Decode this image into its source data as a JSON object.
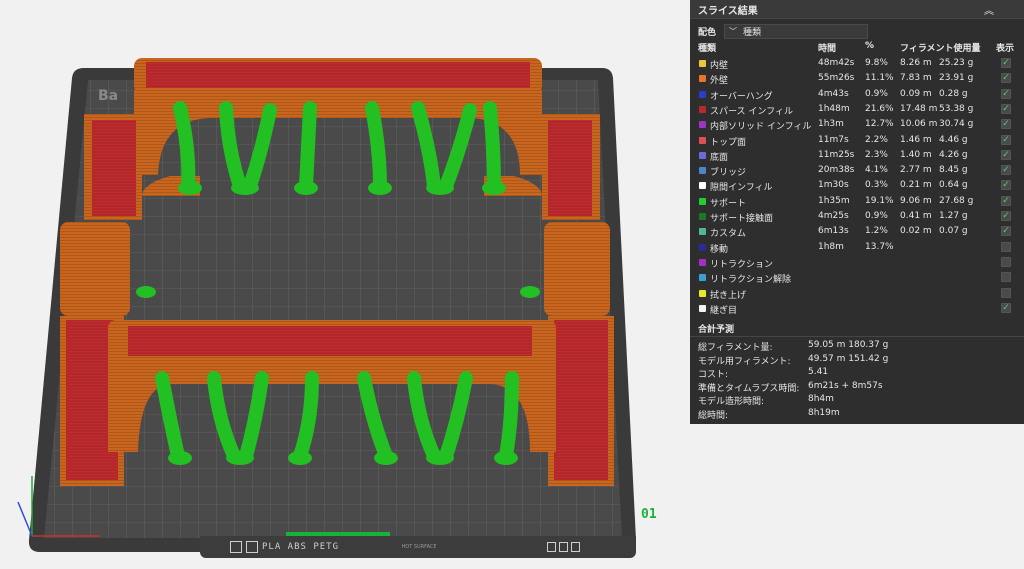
{
  "viewport": {
    "plate_label": "Ba",
    "plate_number": "01",
    "bar_material": "PLA ABS PETG",
    "bar_surface": "HOT SURFACE"
  },
  "panel": {
    "title": "スライス結果",
    "scheme_label": "配色",
    "scheme_value": "種類",
    "headers": {
      "type": "種類",
      "time": "時間",
      "percent": "%",
      "filament": "フィラメント使用量",
      "show": "表示"
    },
    "rows": [
      {
        "name": "内壁",
        "color": "#f0c33c",
        "time": "48m42s",
        "percent": "9.8%",
        "meters": "8.26 m",
        "grams": "25.23 g",
        "checked": true
      },
      {
        "name": "外壁",
        "color": "#e8762a",
        "time": "55m26s",
        "percent": "11.1%",
        "meters": "7.83 m",
        "grams": "23.91 g",
        "checked": true
      },
      {
        "name": "オーバーハング",
        "color": "#2d3bc9",
        "time": "4m43s",
        "percent": "0.9%",
        "meters": "0.09 m",
        "grams": "0.28 g",
        "checked": true
      },
      {
        "name": "スパース インフィル",
        "color": "#b52a2a",
        "time": "1h48m",
        "percent": "21.6%",
        "meters": "17.48 m",
        "grams": "53.38 g",
        "checked": true
      },
      {
        "name": "内部ソリッド インフィル",
        "color": "#9c35c4",
        "time": "1h3m",
        "percent": "12.7%",
        "meters": "10.06 m",
        "grams": "30.74 g",
        "checked": true
      },
      {
        "name": "トップ面",
        "color": "#e05050",
        "time": "11m7s",
        "percent": "2.2%",
        "meters": "1.46 m",
        "grams": "4.46 g",
        "checked": true
      },
      {
        "name": "底面",
        "color": "#6a6ad8",
        "time": "11m25s",
        "percent": "2.3%",
        "meters": "1.40 m",
        "grams": "4.26 g",
        "checked": true
      },
      {
        "name": "ブリッジ",
        "color": "#4a86c8",
        "time": "20m38s",
        "percent": "4.1%",
        "meters": "2.77 m",
        "grams": "8.45 g",
        "checked": true
      },
      {
        "name": "隙間インフィル",
        "color": "#ffffff",
        "time": "1m30s",
        "percent": "0.3%",
        "meters": "0.21 m",
        "grams": "0.64 g",
        "checked": true
      },
      {
        "name": "サポート",
        "color": "#1fd12f",
        "time": "1h35m",
        "percent": "19.1%",
        "meters": "9.06 m",
        "grams": "27.68 g",
        "checked": true
      },
      {
        "name": "サポート接触面",
        "color": "#1a7a24",
        "time": "4m25s",
        "percent": "0.9%",
        "meters": "0.41 m",
        "grams": "1.27 g",
        "checked": true
      },
      {
        "name": "カスタム",
        "color": "#4fb89a",
        "time": "6m13s",
        "percent": "1.2%",
        "meters": "0.02 m",
        "grams": "0.07 g",
        "checked": true
      },
      {
        "name": "移動",
        "color": "#2a2a9a",
        "time": "1h8m",
        "percent": "13.7%",
        "meters": "",
        "grams": "",
        "checked": false
      },
      {
        "name": "リトラクション",
        "color": "#a030c0",
        "time": "",
        "percent": "",
        "meters": "",
        "grams": "",
        "checked": false
      },
      {
        "name": "リトラクション解除",
        "color": "#3aa0d0",
        "time": "",
        "percent": "",
        "meters": "",
        "grams": "",
        "checked": false
      },
      {
        "name": "拭き上げ",
        "color": "#e8e82a",
        "time": "",
        "percent": "",
        "meters": "",
        "grams": "",
        "checked": false
      },
      {
        "name": "継ぎ目",
        "color": "#f4f4f4",
        "time": "",
        "percent": "",
        "meters": "",
        "grams": "",
        "checked": true
      }
    ],
    "totals_title": "合計予測",
    "totals": [
      {
        "label": "総フィラメント量:",
        "value": "59.05 m    180.37 g"
      },
      {
        "label": "モデル用フィラメント:",
        "value": "49.57 m    151.42 g"
      },
      {
        "label": "コスト:",
        "value": "5.41"
      },
      {
        "label": "準備とタイムラプス時間:",
        "value": "6m21s + 8m57s"
      },
      {
        "label": "モデル造形時間:",
        "value": "8h4m"
      },
      {
        "label": "総時間:",
        "value": "8h19m"
      }
    ]
  },
  "colors": {
    "plate": "#3a3a3a",
    "model_orange": "#c8651e",
    "model_red": "#b3262a",
    "support_green": "#22c022"
  }
}
